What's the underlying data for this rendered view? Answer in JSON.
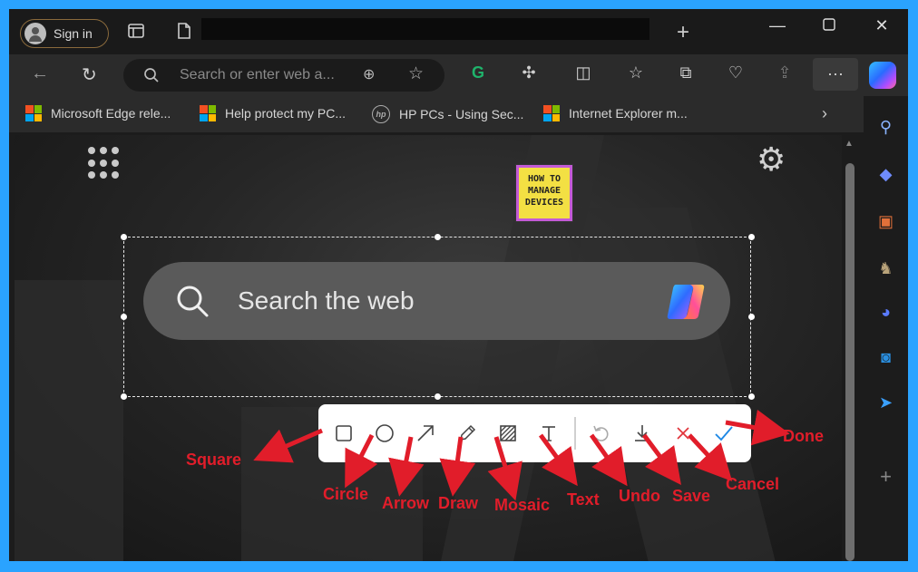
{
  "browser": {
    "sign_in_label": "Sign in",
    "search_placeholder": "Search or enter web a...",
    "favorites": [
      {
        "label": "Microsoft Edge rele...",
        "icon": "microsoft-logo"
      },
      {
        "label": "Help protect my PC...",
        "icon": "microsoft-logo"
      },
      {
        "label": "HP PCs - Using Sec...",
        "icon": "hp-logo"
      },
      {
        "label": "Internet Explorer m...",
        "icon": "microsoft-logo"
      }
    ],
    "hp_logo_text": "hp"
  },
  "new_tab_page": {
    "logo_lines": [
      "HOW TO",
      "MANAGE",
      "DEVICES"
    ],
    "search_placeholder": "Search the web"
  },
  "screenshot_toolbar": {
    "tools": [
      {
        "name": "square",
        "icon": "square-icon"
      },
      {
        "name": "circle",
        "icon": "circle-icon"
      },
      {
        "name": "arrow",
        "icon": "arrow-icon"
      },
      {
        "name": "draw",
        "icon": "pencil-icon"
      },
      {
        "name": "mosaic",
        "icon": "mosaic-icon"
      },
      {
        "name": "text",
        "icon": "text-icon"
      },
      {
        "name": "undo",
        "icon": "undo-icon"
      },
      {
        "name": "save",
        "icon": "download-icon"
      },
      {
        "name": "cancel",
        "icon": "close-icon"
      },
      {
        "name": "done",
        "icon": "check-icon"
      }
    ]
  },
  "annotations": {
    "square": "Square",
    "circle": "Circle",
    "arrow": "Arrow",
    "draw": "Draw",
    "mosaic": "Mosaic",
    "text": "Text",
    "undo": "Undo",
    "save": "Save",
    "cancel": "Cancel",
    "done": "Done"
  },
  "colors": {
    "frame_border": "#2aa3ff",
    "annotation_red": "#e11d2a",
    "toolbar_bg": "#ffffff",
    "cancel_red": "#e0333a",
    "done_blue": "#1e88e5"
  }
}
